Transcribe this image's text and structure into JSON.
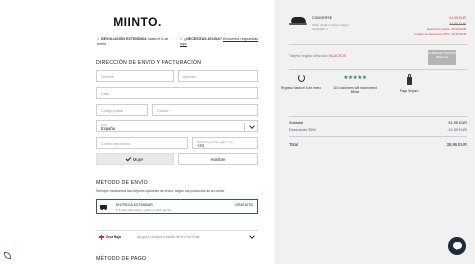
{
  "header": {
    "logo": "MIINTO.",
    "note1_bold": "DEVOLUCIÓN EXTENDIDA",
    "note1_rest": " hasta el 6 de enero",
    "note2_bold": "¿NECESITAS AYUDA?",
    "note2_link": "Encuentra respuestas aquí"
  },
  "address": {
    "title": "DIRECCIÓN DE ENVÍO Y FACTURACIÓN",
    "name_placeholder": "Nombre",
    "surname_placeholder": "Apellido",
    "street_placeholder": "Calle",
    "postal_placeholder": "Código postal",
    "city_placeholder": "Ciudad",
    "country_label": "País",
    "country_value": "España",
    "email_placeholder": "Correo electrónico",
    "phone_label": "Teléfono (prefijo país + N)",
    "phone_value": "+34",
    "gender_female": "Mujer",
    "gender_male": "Hombre",
    "gender_selected": "Mujer"
  },
  "shipping": {
    "title": "MÉTODO DE ENVÍO",
    "desc": "Siempre mostramos las mejores opciones de envío, según los productos de su cesta.",
    "option_name": "ENTREGA ESTÁNDAR",
    "option_sub": "1-5 días laborables, gratis a partir de 50,-",
    "option_price": "GRATUITO",
    "red_cross_name": "Cruz Roja",
    "red_cross_text": "Apoya a Ucrania a través de la Cruz Roja"
  },
  "payment": {
    "title": "MÉTODO DE PAGO"
  },
  "cart": {
    "product_name": "CONVERSE",
    "product_meta1": "Talla: 41 EU  |  Color: Negro",
    "product_meta2": "Cantidad: 1",
    "price_now": "51,95 EUR",
    "price_old": "64,95 EUR",
    "discount1": "Descuento editor -45,00 EUR",
    "discount2": "Código de descuento 25% -12,99 EUR",
    "promo_text": "Tarjeta regalo utilizado: ",
    "promo_code": "BLACK25",
    "promo_button": "Eliminar tarjeta regalo",
    "features": [
      {
        "icon": "refresh-icon",
        "text": "Regreso hasta el 6 de enero"
      },
      {
        "icon": "stars-icon",
        "stars": "★★★★★",
        "text": "110 customers will recommend Miinto"
      },
      {
        "icon": "lock-icon",
        "text": "Pago Seguro"
      }
    ],
    "rating": 4.5,
    "subtotal_label": "Subtotal",
    "subtotal_value": "51,95 EUR",
    "discount_label": "Descuento 25%",
    "discount_value": "-12,99 EUR",
    "total_label": "Total",
    "total_value": "38,96 EUR"
  },
  "colors": {
    "accent_price": "#d6382a",
    "discount_blue": "#2d6a83",
    "chat_bg": "#1d2b3a",
    "stars_green": "#1c8a5a"
  }
}
